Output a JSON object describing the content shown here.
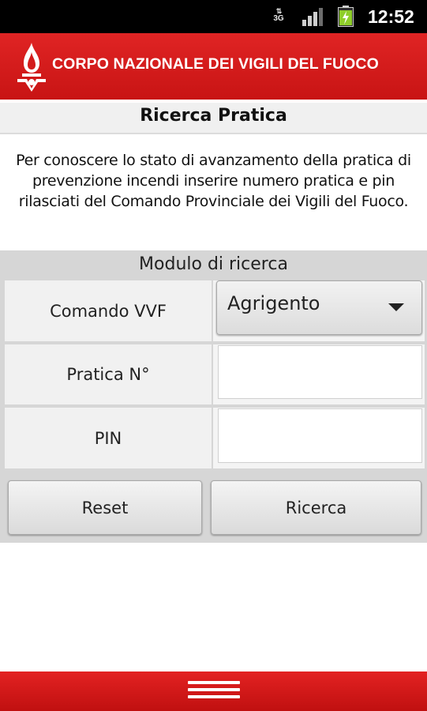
{
  "status_bar": {
    "network": "3G",
    "time": "12:52",
    "icons": [
      "data-3g-icon",
      "signal-icon",
      "battery-charging-icon"
    ]
  },
  "header": {
    "organization": "CORPO NAZIONALE DEI VIGILI DEL FUOCO",
    "logo_icon": "fire-brigade-emblem-icon"
  },
  "page": {
    "title": "Ricerca Pratica",
    "intro": "Per conoscere lo stato di avanzamento della pratica di prevenzione incendi inserire numero pratica e pin rilasciati del Comando Provinciale dei Vigili del Fuoco."
  },
  "form": {
    "title": "Modulo di ricerca",
    "comando_label": "Comando VVF",
    "comando_value": "Agrigento",
    "pratica_label": "Pratica N°",
    "pratica_value": "",
    "pin_label": "PIN",
    "pin_value": "",
    "reset_label": "Reset",
    "search_label": "Ricerca"
  },
  "bottom_bar": {
    "menu_icon": "menu-icon"
  },
  "colors": {
    "brand_red": "#d31c1c",
    "panel_gray": "#d6d6d6"
  }
}
